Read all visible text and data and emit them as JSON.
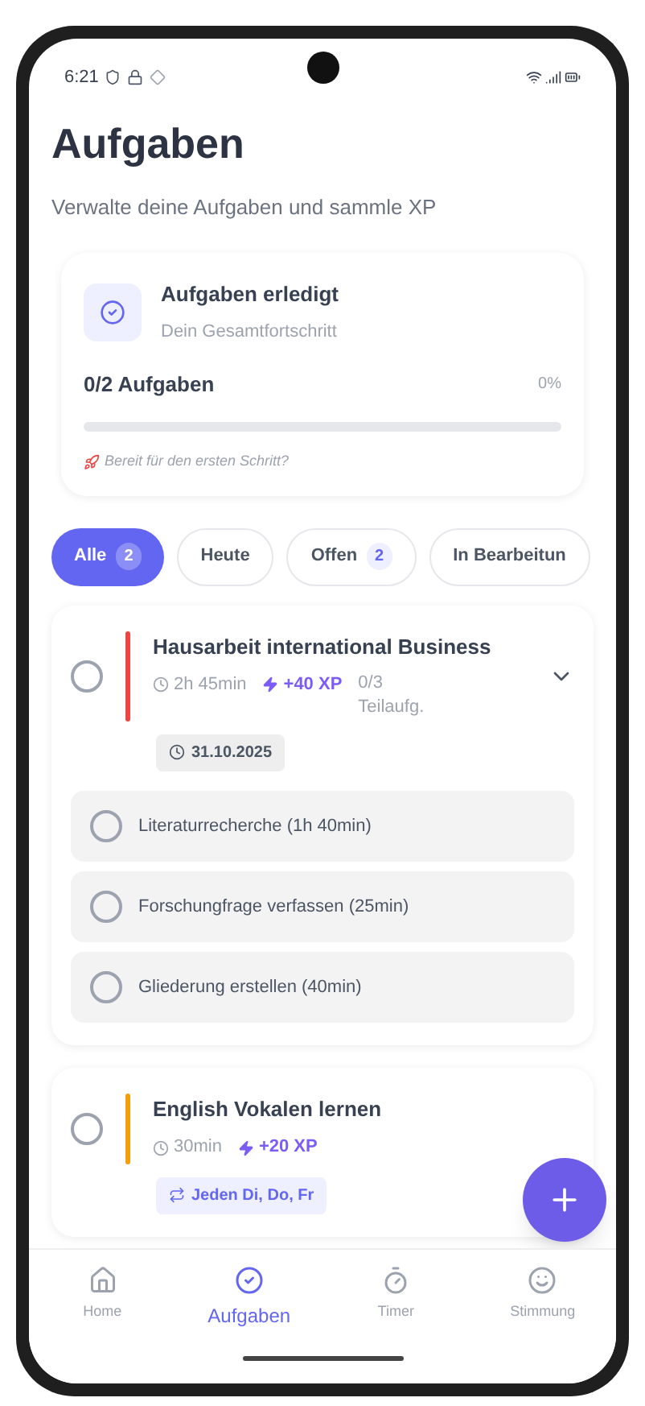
{
  "status_bar": {
    "time": "6:21"
  },
  "header": {
    "title": "Aufgaben",
    "subtitle": "Verwalte deine Aufgaben und sammle XP"
  },
  "progress_card": {
    "title": "Aufgaben erledigt",
    "subtitle": "Dein Gesamtfortschritt",
    "count": "0/2 Aufgaben",
    "percent": "0%",
    "level": 0,
    "hint": "Bereit für den ersten Schritt?"
  },
  "filters": [
    {
      "label": "Alle",
      "count": "2",
      "selected": true
    },
    {
      "label": "Heute",
      "selected": false
    },
    {
      "label": "Offen",
      "count": "2",
      "selected": false
    },
    {
      "label": "In Bearbeitun",
      "selected": false
    }
  ],
  "tasks": [
    {
      "title": "Hausarbeit international Business",
      "color": "#ef4444",
      "checked": false,
      "duration": "2h 45min",
      "xp": "+40 XP",
      "subtask_count": "0/3 Teilaufg.",
      "tag": {
        "kind": "date",
        "text": "31.10.2025"
      },
      "expanded": true,
      "subtasks": [
        {
          "label": "Literaturrecherche (1h 40min)",
          "checked": false
        },
        {
          "label": "Forschungfrage verfassen (25min)",
          "checked": false
        },
        {
          "label": "Gliederung erstellen (40min)",
          "checked": false
        }
      ]
    },
    {
      "title": "English Vokalen lernen",
      "color": "#f59e0b",
      "checked": false,
      "duration": "30min",
      "xp": "+20 XP",
      "tag": {
        "kind": "repeat",
        "text": "Jeden Di, Do, Fr"
      }
    }
  ],
  "nav": [
    {
      "label": "Home",
      "selected": false
    },
    {
      "label": "Aufgaben",
      "selected": true
    },
    {
      "label": "Timer",
      "selected": false
    },
    {
      "label": "Stimmung",
      "selected": false
    }
  ]
}
